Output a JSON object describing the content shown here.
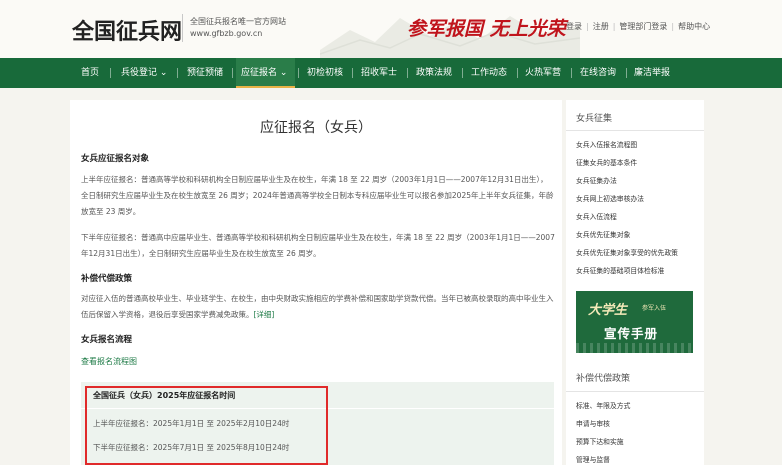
{
  "header": {
    "logo_title": "全国征兵网",
    "logo_sub1": "全国征兵报名唯一官方网站",
    "logo_sub2": "www.gfbzb.gov.cn",
    "slogan": "参军报国 无上光荣",
    "top_links": [
      "登录",
      "注册",
      "管理部门登录",
      "帮助中心"
    ]
  },
  "nav": {
    "items": [
      {
        "label": "首页"
      },
      {
        "label": "兵役登记 ⌄"
      },
      {
        "label": "预征预储"
      },
      {
        "label": "应征报名 ⌄"
      },
      {
        "label": "初检初核"
      },
      {
        "label": "招收军士"
      },
      {
        "label": "政策法规"
      },
      {
        "label": "工作动态"
      },
      {
        "label": "火热军营"
      },
      {
        "label": "在线咨询"
      },
      {
        "label": "廉洁举报"
      }
    ],
    "active_index": 3,
    "bg_color": "#186a3a",
    "active_underline_color": "#e9b347"
  },
  "main": {
    "title": "应征报名（女兵）",
    "sections": {
      "target_heading": "女兵应征报名对象",
      "target_para1": "上半年应征报名：普通高等学校和科研机构全日制应届毕业生及在校生，年满 18 至 22 周岁（2003年1月1日——2007年12月31日出生），全日制研究生应届毕业生及在校生放宽至 26 周岁；2024年普通高等学校全日制本专科应届毕业生可以报名参加2025年上半年女兵征集，年龄放宽至 23 周岁。",
      "target_para2": "下半年应征报名：普通高中应届毕业生、普通高等学校和科研机构全日制应届毕业生及在校生，年满 18 至 22 周岁（2003年1月1日——2007年12月31日出生），全日制研究生应届毕业生及在校生放宽至 26 周岁。",
      "comp_heading": "补偿代偿政策",
      "comp_para": "对应征入伍的普通高校毕业生、毕业班学生、在校生，由中央财政实施相应的学费补偿和国家助学贷款代偿。当年已被高校录取的高中毕业生入伍后保留入学资格，退役后享受国家学费减免政策。",
      "comp_link": "[详细]",
      "flow_heading": "女兵报名流程",
      "flow_link": "查看报名流程图"
    },
    "time_box": {
      "title": "全国征兵（女兵）2025年应征报名时间",
      "rows": [
        "上半年应征报名：2025年1月1日 至 2025年2月10日24时",
        "下半年应征报名：2025年7月1日 至 2025年8月10日24时"
      ],
      "highlight_color": "#e02a2a"
    }
  },
  "sidebar": {
    "heading1": "女兵征集",
    "items1": [
      "女兵入伍报名流程图",
      "征集女兵的基本条件",
      "女兵征集办法",
      "女兵网上初选审核办法",
      "女兵入伍流程",
      "女兵优先征集对象",
      "女兵优先征集对象享受的优先政策",
      "女兵征集的基础项目体检标准"
    ],
    "banner": {
      "line1": "大学生",
      "line2": "参军入伍",
      "line3": "宣传手册"
    },
    "heading2": "补偿代偿政策",
    "items2": [
      "标准、年限及方式",
      "申请与审核",
      "预算下达和实施",
      "管理与监督"
    ]
  }
}
